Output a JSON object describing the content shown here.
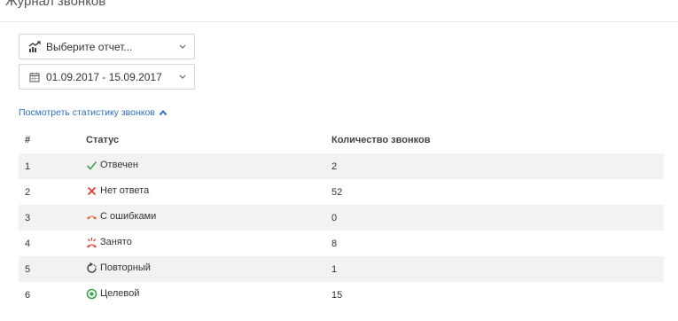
{
  "header": {
    "title": "Журнал звонков"
  },
  "filters": {
    "report_select": {
      "value": "Выберите отчет...",
      "icon": "chart-icon"
    },
    "date_range": {
      "value": "01.09.2017 - 15.09.2017",
      "icon": "calendar-icon"
    }
  },
  "stats_link": {
    "label": "Посмотреть статистику звонков",
    "icon": "chevron-up-icon"
  },
  "table": {
    "headers": [
      "#",
      "Статус",
      "Количество звонков"
    ],
    "rows": [
      {
        "num": "1",
        "status": "Отвечен",
        "count": "2",
        "icon": "check-icon",
        "color": "#3fa34d"
      },
      {
        "num": "2",
        "status": "Нет ответа",
        "count": "52",
        "icon": "cross-icon",
        "color": "#e53935"
      },
      {
        "num": "3",
        "status": "С ошибками",
        "count": "0",
        "icon": "hangup-icon",
        "color": "#e65c1a"
      },
      {
        "num": "4",
        "status": "Занято",
        "count": "8",
        "icon": "busy-icon",
        "color": "#e53935"
      },
      {
        "num": "5",
        "status": "Повторный",
        "count": "1",
        "icon": "repeat-icon",
        "color": "#444444"
      },
      {
        "num": "6",
        "status": "Целевой",
        "count": "15",
        "icon": "target-icon",
        "color": "#3fa34d"
      }
    ]
  }
}
